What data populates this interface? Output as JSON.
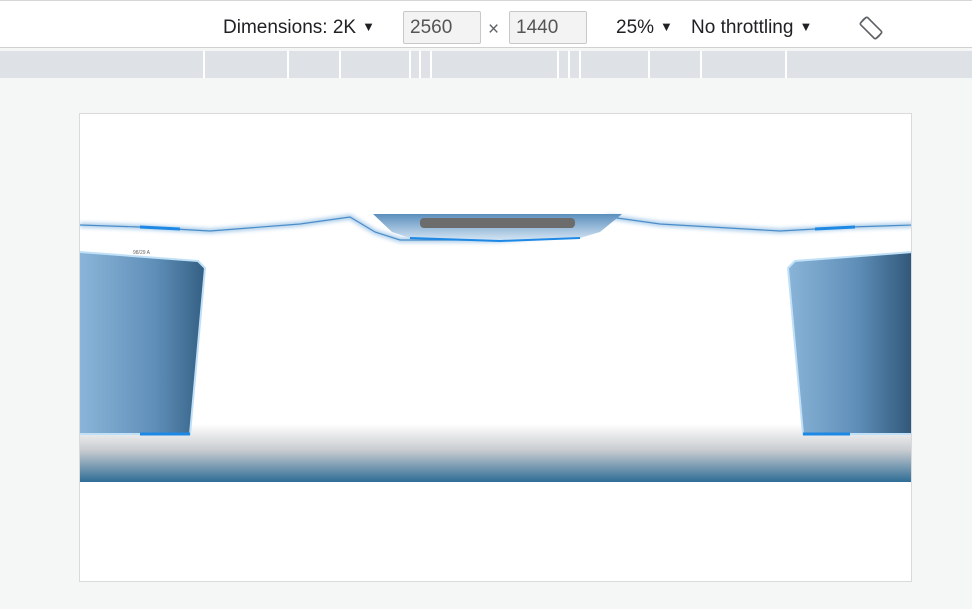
{
  "toolbar": {
    "dimensions_label": "Dimensions: 2K",
    "width_value": "2560",
    "height_value": "1440",
    "times_symbol": "×",
    "zoom_label": "25%",
    "throttling_label": "No throttling",
    "dropdown_glyph": "▼"
  },
  "icons": {
    "rotate": "rotate-device-icon",
    "dropdown": "triangle-down-icon"
  },
  "viewport": {
    "caption": "98/29 A"
  },
  "colors": {
    "accent_blue": "#1e88e5",
    "panel_blue_light": "#8ab4d8",
    "panel_blue_dark": "#3d6d93",
    "floor_blue": "#2f6c96",
    "mq_bar": "#dee1e6"
  }
}
